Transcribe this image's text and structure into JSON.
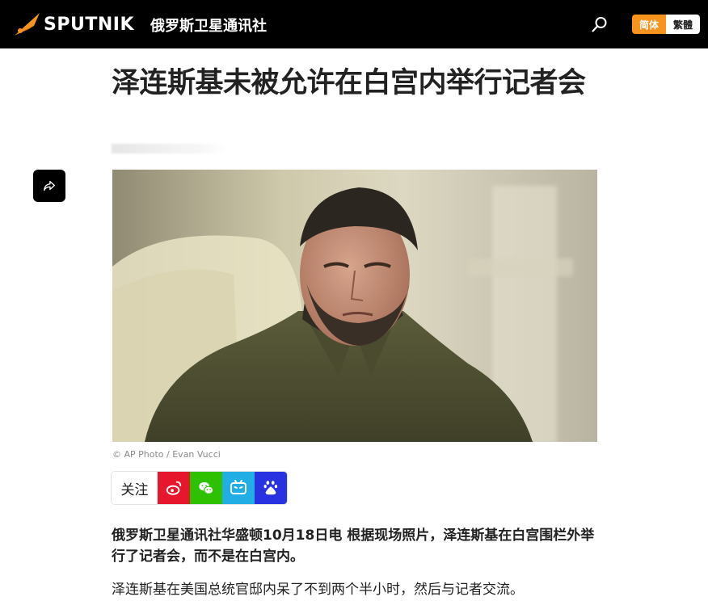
{
  "header": {
    "brand": "SPUTNIK",
    "brand_sub": "俄罗斯卫星通讯社",
    "lang_simplified": "简体",
    "lang_traditional": "繁體",
    "accent_color": "#f7941d"
  },
  "article": {
    "title": "泽连斯基未被允许在白宫内举行记者会",
    "photo_credit": "© AP Photo / Evan Vucci",
    "lead": "俄罗斯卫星通讯社华盛顿10月18日电 根据现场照片，泽连斯基在白宫围栏外举行了记者会，而不是在白宫内。",
    "paragraph_1": "泽连斯基在美国总统官邸内呆了不到两个半小时，然后与记者交流。"
  },
  "share": {
    "follow_label": "关注",
    "icons": [
      "weibo-icon",
      "wechat-icon",
      "bilibili-icon",
      "baidu-icon"
    ]
  }
}
